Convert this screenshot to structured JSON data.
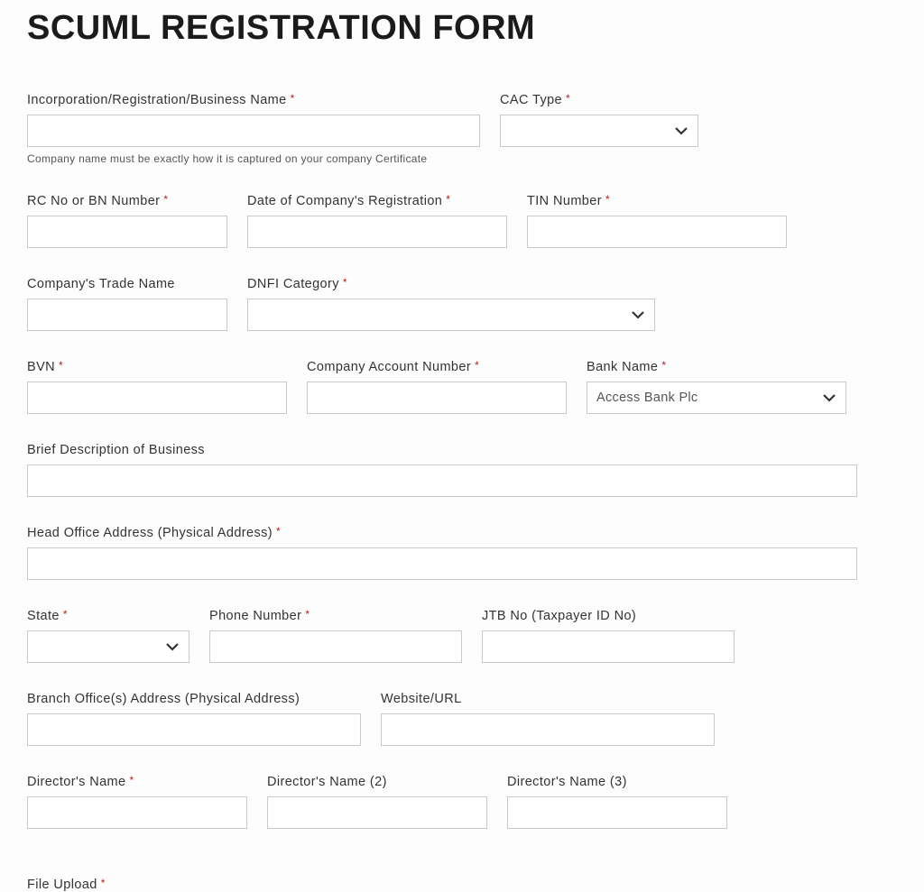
{
  "title": "SCUML REGISTRATION FORM",
  "fields": {
    "incorporation_name": {
      "label": "Incorporation/Registration/Business Name",
      "required": true,
      "help": "Company name must be exactly how it is captured on your company Certificate"
    },
    "cac_type": {
      "label": "CAC Type",
      "required": true,
      "value": ""
    },
    "rc_bn_number": {
      "label": "RC No or BN Number",
      "required": true
    },
    "registration_date": {
      "label": "Date of Company's Registration",
      "required": true
    },
    "tin_number": {
      "label": "TIN Number",
      "required": true
    },
    "trade_name": {
      "label": "Company's Trade Name",
      "required": false
    },
    "dnfi_category": {
      "label": "DNFI Category",
      "required": true,
      "value": ""
    },
    "bvn": {
      "label": "BVN",
      "required": true
    },
    "account_number": {
      "label": "Company Account Number",
      "required": true
    },
    "bank_name": {
      "label": "Bank Name",
      "required": true,
      "value": "Access Bank Plc"
    },
    "description": {
      "label": "Brief Description of Business",
      "required": false
    },
    "head_office": {
      "label": "Head Office Address (Physical Address)",
      "required": true
    },
    "state": {
      "label": "State",
      "required": true,
      "value": ""
    },
    "phone": {
      "label": "Phone Number",
      "required": true
    },
    "jtb": {
      "label": "JTB No (Taxpayer ID No)",
      "required": false
    },
    "branch_office": {
      "label": "Branch Office(s) Address (Physical Address)",
      "required": false
    },
    "website": {
      "label": "Website/URL",
      "required": false
    },
    "director1": {
      "label": "Director's Name",
      "required": true
    },
    "director2": {
      "label": "Director's Name (2)",
      "required": false
    },
    "director3": {
      "label": "Director's Name (3)",
      "required": false
    },
    "file_upload": {
      "label": "File Upload",
      "required": true
    }
  },
  "asterisk": "*"
}
